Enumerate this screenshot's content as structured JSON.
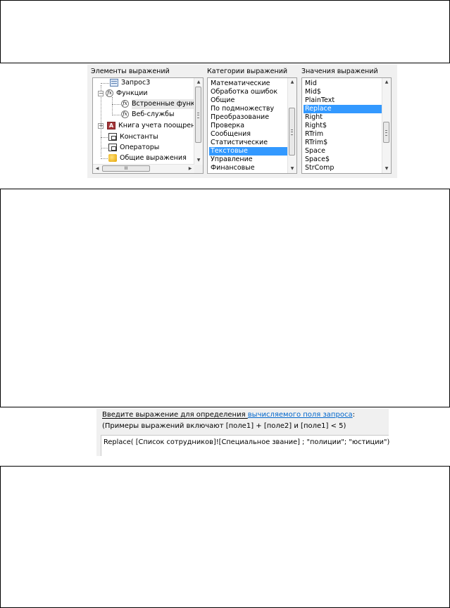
{
  "builder": {
    "elements": {
      "label": "Элементы выражений",
      "items": [
        "Запрос3",
        "Функции",
        "Встроенные функ",
        "Веб-службы",
        "Книга учета поощрен",
        "Константы",
        "Операторы",
        "Общие выражения"
      ],
      "hscroll_grip": "III"
    },
    "categories": {
      "label": "Категории выражений",
      "items": [
        "Математические",
        "Обработка ошибок",
        "Общие",
        "По подмножеству",
        "Преобразование",
        "Проверка",
        "Сообщения",
        "Статистические",
        "Текстовые",
        "Управление",
        "Финансовые"
      ],
      "selected": "Текстовые"
    },
    "values": {
      "label": "Значения выражений",
      "items": [
        "Mid",
        "Mid$",
        "PlainText",
        "Replace",
        "Right",
        "Right$",
        "RTrim",
        "RTrim$",
        "Space",
        "Space$",
        "StrComp"
      ],
      "selected": "Replace"
    },
    "colors": {
      "selection": "#3399ff",
      "panel_bg": "#f0f0f0"
    }
  },
  "entry": {
    "prompt_prefix": "Введите выражение для определения ",
    "prompt_link": "вычисляемого поля запроса",
    "prompt_suffix": ":",
    "examples": "(Примеры выражений включают [поле1] + [поле2] и [поле1] < 5)",
    "expression": "Replace( [Список сотрудников]![Специальное звание]  ; \"полиции\"; \"юстиции\")"
  }
}
